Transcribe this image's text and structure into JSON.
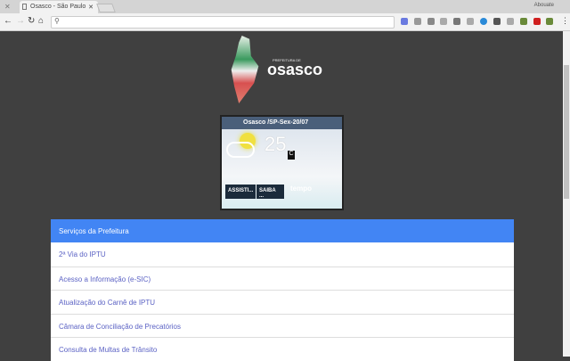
{
  "browser": {
    "tab_title": "Osasco - São Paulo",
    "user": "Abouate",
    "address": ""
  },
  "logo": {
    "pretitle": "PREFEITURA DE",
    "name": "osasco"
  },
  "weather": {
    "title": "Osasco /SP-Sex-20/07",
    "temperature": "25",
    "unit": "C",
    "button1": "ASSISTI...",
    "button2": "SAIBA ...",
    "brand": "tempo"
  },
  "services": {
    "header": "Serviços da Prefeitura",
    "items": [
      "2ª Via do IPTU",
      "Acesso a Informação (e-SIC)",
      "Atualização do Carnê de IPTU",
      "Câmara de Conciliação de Precatórios",
      "Consulta de Multas de Trânsito"
    ]
  },
  "colors": {
    "header": "#4285f4",
    "link": "#5b62c4",
    "background": "#404040"
  }
}
